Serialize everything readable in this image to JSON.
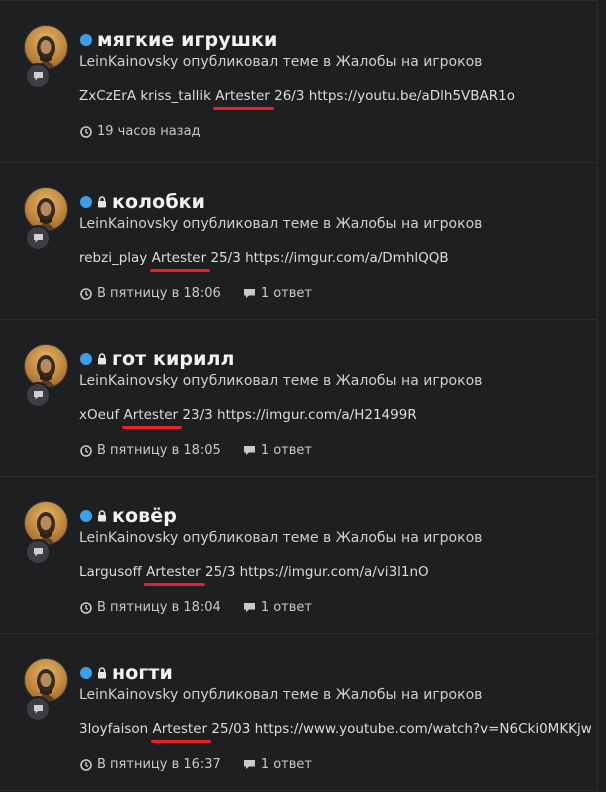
{
  "colors": {
    "background": "#1e1f21",
    "status_dot": "#3aa0e8",
    "underline": "#e8202a"
  },
  "icons": {
    "status": "unread-dot-icon",
    "lock": "lock-icon",
    "avatar_badge": "chat-bubble-icon",
    "time": "clock-icon",
    "replies": "chat-bubble-icon"
  },
  "items": [
    {
      "title": "мягкие игрушки",
      "locked": false,
      "meta": "LeinKainovsky опубликовал теме в Жалобы на игроков",
      "snippet_before": "ZxCzErA kriss_tallik ",
      "snippet_highlight": "Artester",
      "snippet_after": " 26/3 https://youtu.be/aDlh5VBAR1o",
      "time": "19 часов назад",
      "replies": ""
    },
    {
      "title": "колобки",
      "locked": true,
      "meta": "LeinKainovsky опубликовал теме в Жалобы на игроков",
      "snippet_before": "rebzi_play ",
      "snippet_highlight": "Artester",
      "snippet_after": " 25/3 https://imgur.com/a/DmhlQQB",
      "time": "В пятницу в 18:06",
      "replies": "1 ответ"
    },
    {
      "title": "гот кирилл",
      "locked": true,
      "meta": "LeinKainovsky опубликовал теме в Жалобы на игроков",
      "snippet_before": "xOeuf ",
      "snippet_highlight": "Artester",
      "snippet_after": " 23/3 https://imgur.com/a/H21499R",
      "time": "В пятницу в 18:05",
      "replies": "1 ответ"
    },
    {
      "title": "ковёр",
      "locked": true,
      "meta": "LeinKainovsky опубликовал теме в Жалобы на игроков",
      "snippet_before": "Largusoff ",
      "snippet_highlight": "Artester",
      "snippet_after": " 25/3 https://imgur.com/a/vi3l1nO",
      "time": "В пятницу в 18:04",
      "replies": "1 ответ"
    },
    {
      "title": "ногти",
      "locked": true,
      "meta": "LeinKainovsky опубликовал теме в Жалобы на игроков",
      "snippet_before": "3loyfaison ",
      "snippet_highlight": "Artester",
      "snippet_after": " 25/03 https://www.youtube.com/watch?v=N6Cki0MKKjw",
      "time": "В пятницу в 16:37",
      "replies": "1 ответ"
    }
  ]
}
